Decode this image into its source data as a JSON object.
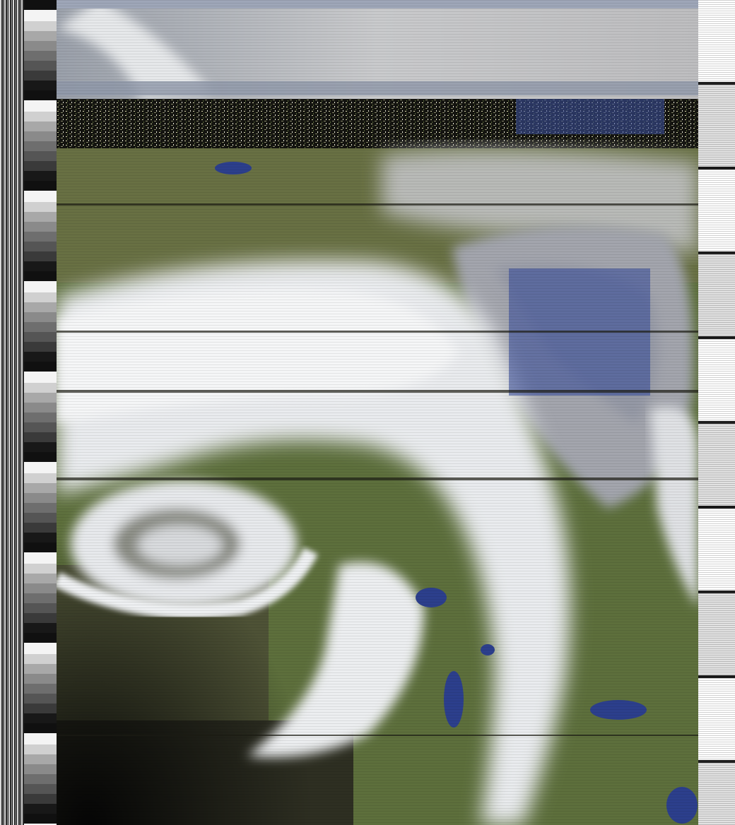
{
  "image": {
    "kind": "weather-satellite-apt-image",
    "description_tags": [
      "left-sync-strip",
      "telemetry-wedges",
      "cloud-imagery",
      "right-telemetry"
    ]
  },
  "colors": {
    "land_green": "#5d6f3c",
    "land_olive": "#6f6a4a",
    "cloud_white": "#eef0f2",
    "cloud_gray": "#b9bcc2",
    "water_blue": "#2a3f8a",
    "noise_band": "#1a1a12"
  },
  "icons": {
    "sync": "sync-strip-icon",
    "telemetry": "telemetry-wedge-icon"
  }
}
